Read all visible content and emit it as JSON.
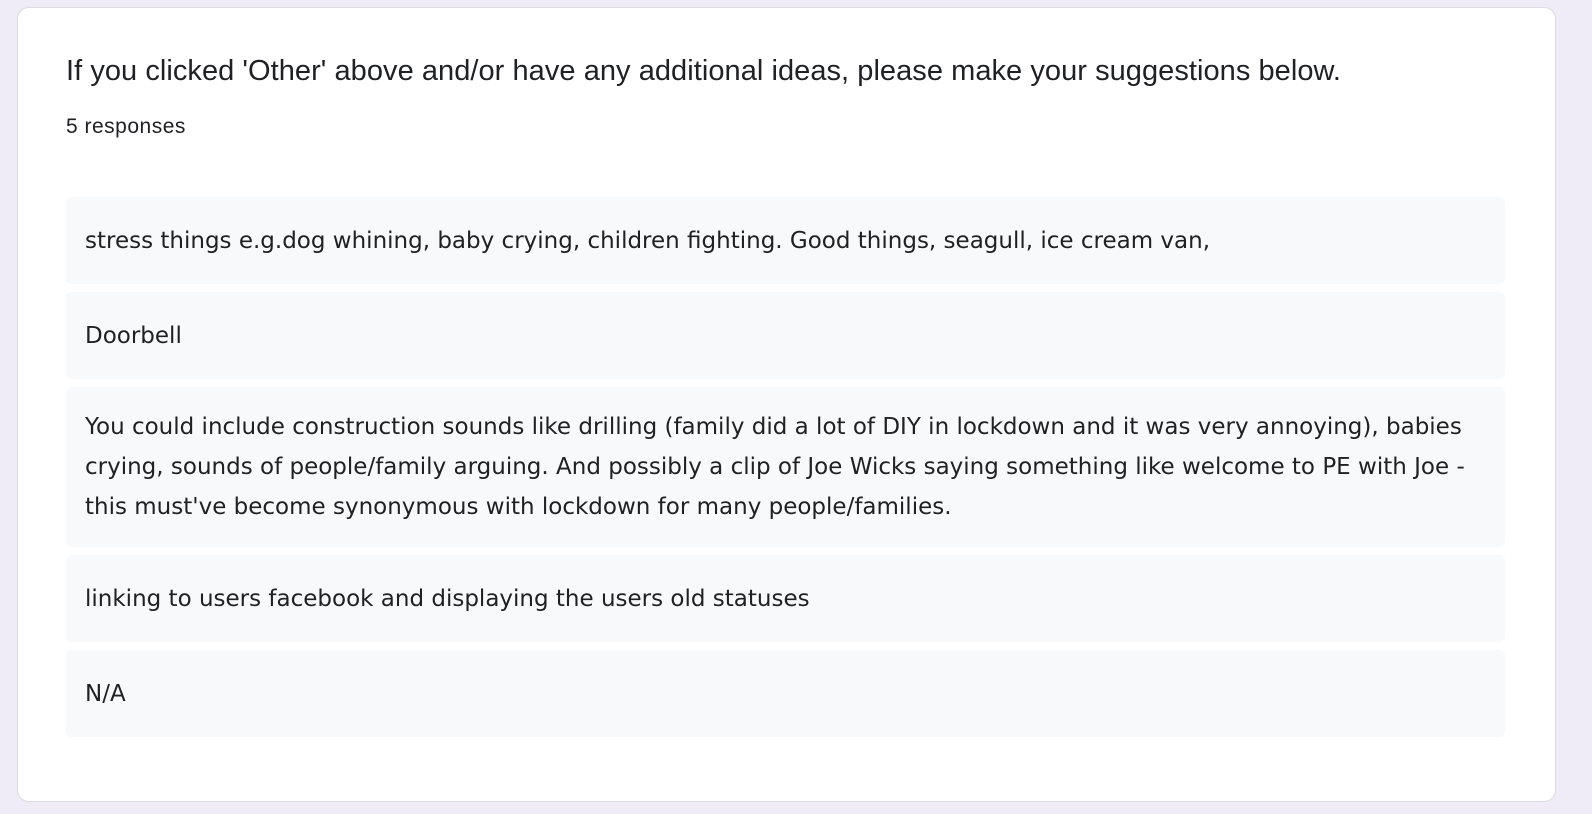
{
  "question": {
    "title": "If you clicked 'Other' above and/or have any additional ideas, please make your suggestions below.",
    "response_count": "5 responses"
  },
  "responses": [
    "stress things e.g.dog whining, baby crying, children fighting. Good things, seagull, ice cream van,",
    "Doorbell",
    "You could include construction sounds like drilling (family did a lot of DIY in lockdown and it was very annoying), babies crying, sounds of people/family arguing. And possibly a clip of Joe Wicks saying something like welcome to PE with Joe - this must've become synonymous with lockdown for many people/families.",
    "linking to users facebook and displaying the users old statuses",
    "N/A"
  ],
  "colors": {
    "page_background": "#efebf7",
    "card_background": "#ffffff",
    "response_background": "#f8f9fa",
    "text": "#202124"
  }
}
